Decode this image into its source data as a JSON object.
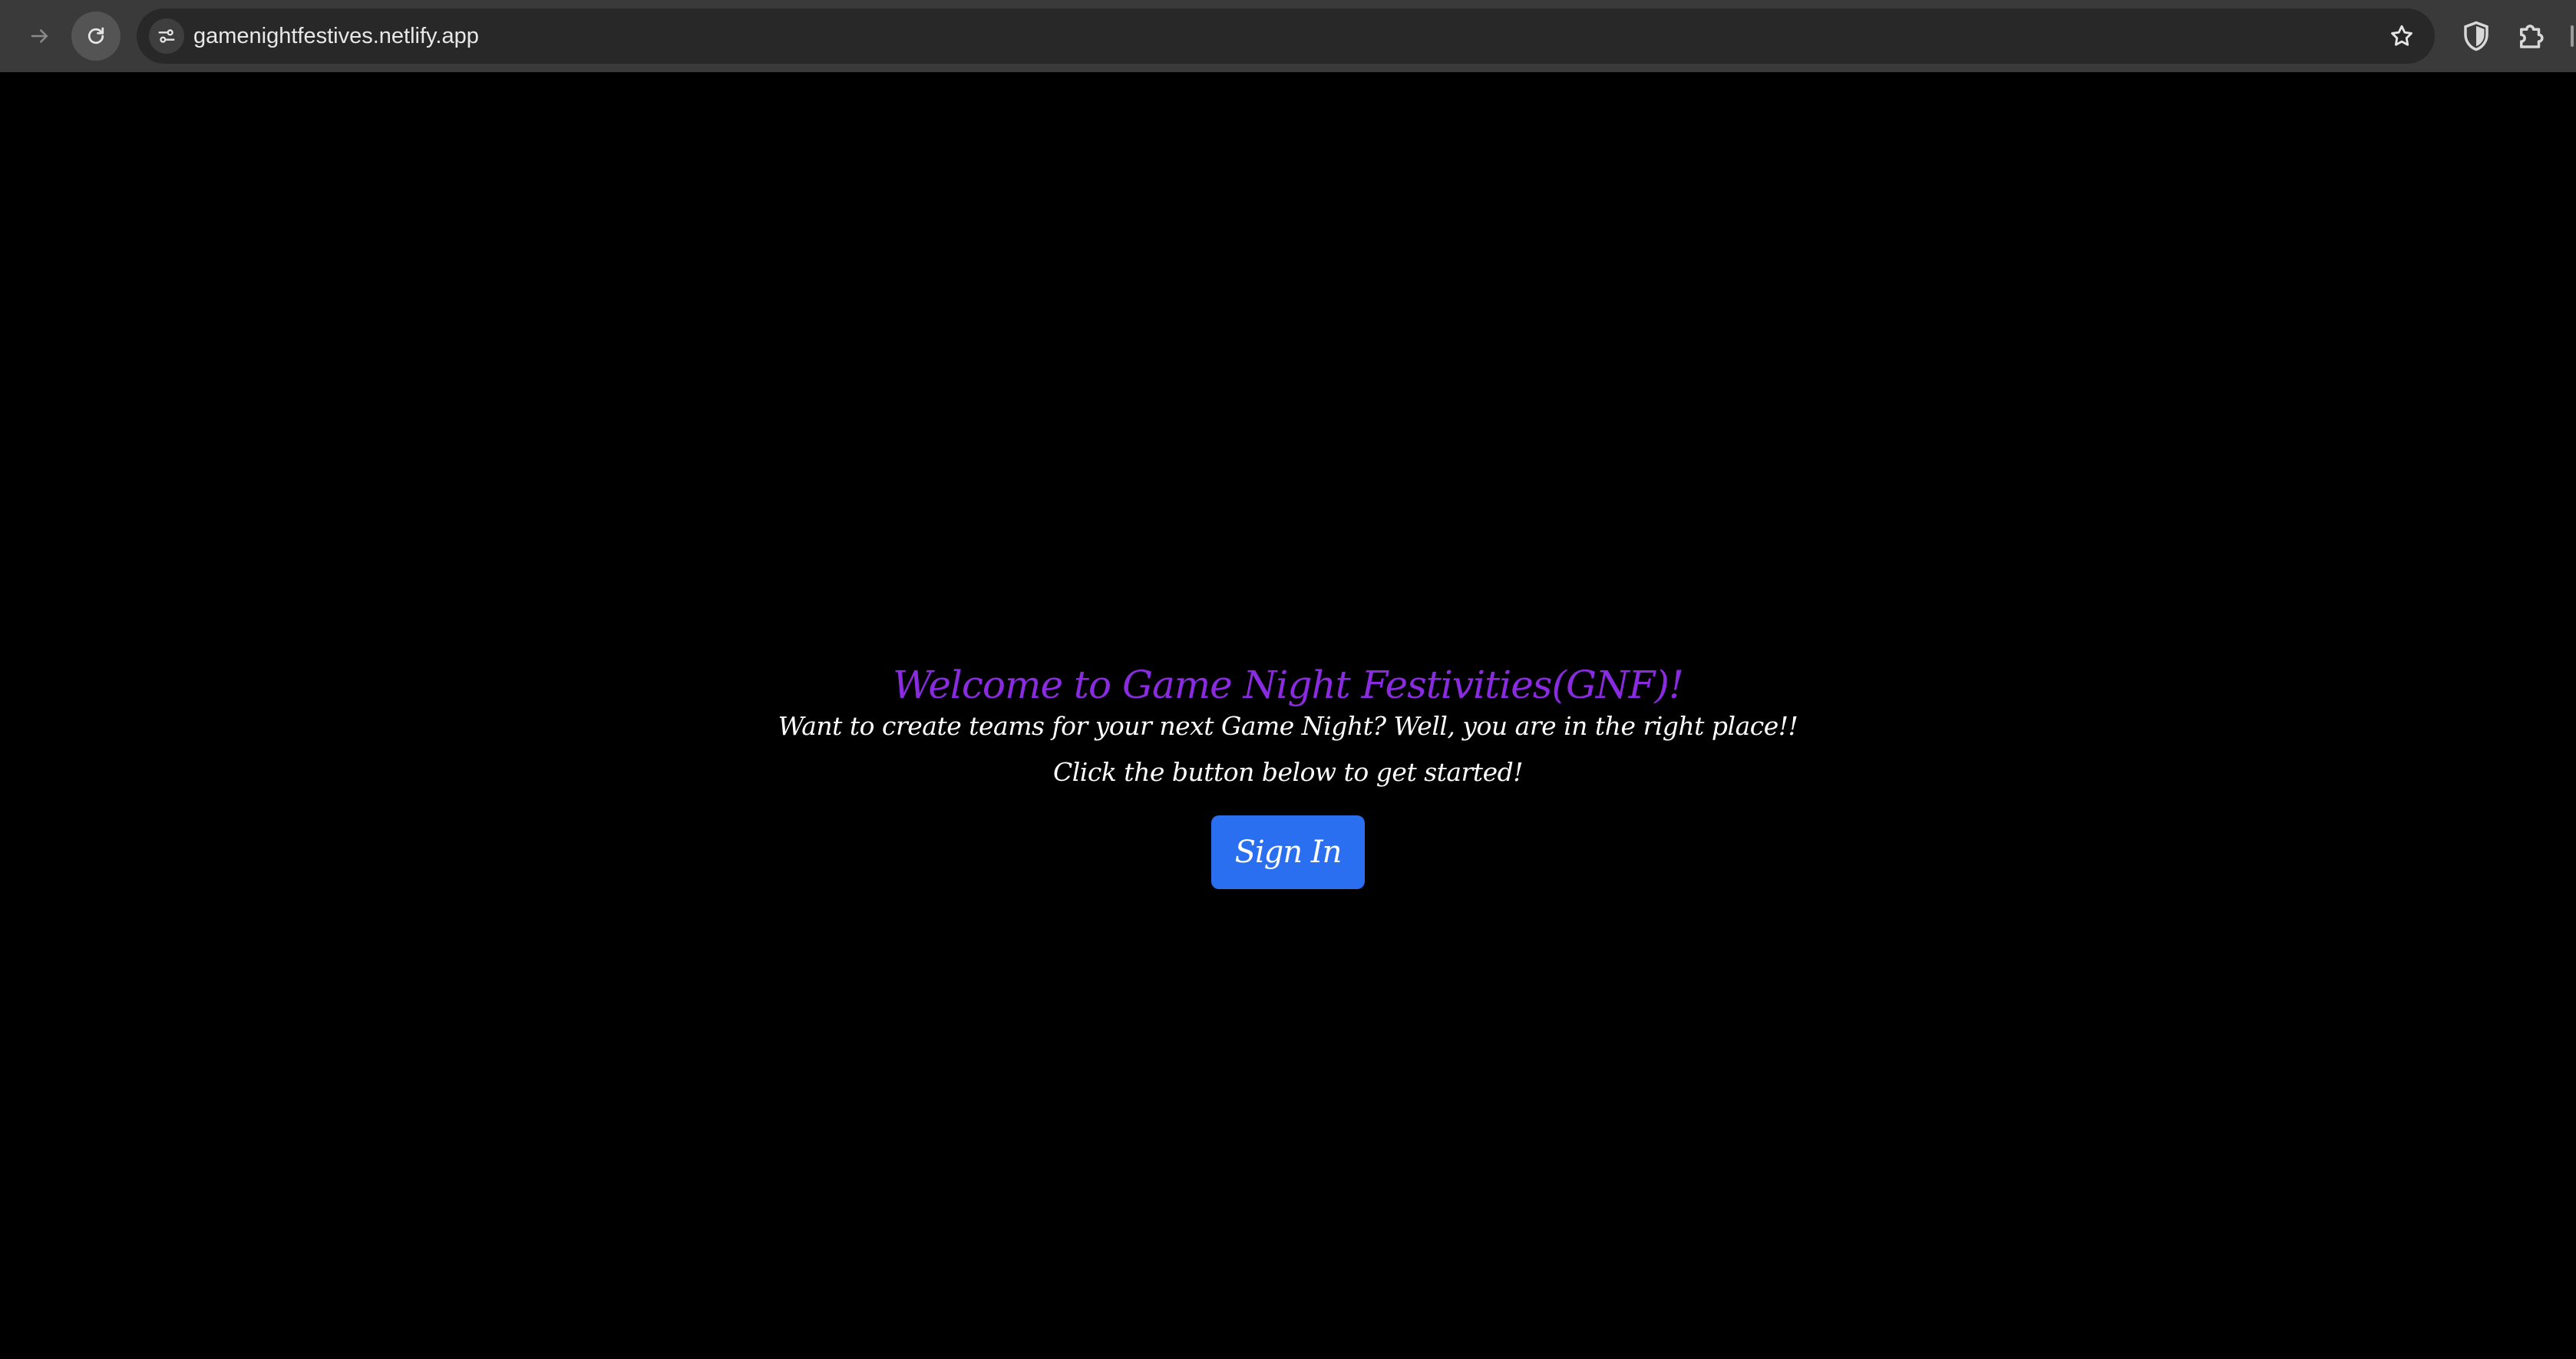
{
  "browser": {
    "url": "gamenightfestives.netlify.app",
    "icons": {
      "forward": "arrow-right-icon",
      "reload": "reload-icon",
      "site_info": "tune-icon",
      "bookmark": "star-icon",
      "extension_1": "shield-icon",
      "extension_2": "puzzle-icon"
    }
  },
  "hero": {
    "title": "Welcome to Game Night Festivities(GNF)!",
    "line1": "Want to create teams for your next Game Night? Well, you are in the right place!!",
    "line2": "Click the button below to get started!",
    "button_label": "Sign In"
  },
  "colors": {
    "background": "#000000",
    "title": "#8a2be2",
    "text": "#ffffff",
    "button": "#2a6ff0",
    "toolbar": "#3a3a3a",
    "omnibox": "#282828"
  }
}
